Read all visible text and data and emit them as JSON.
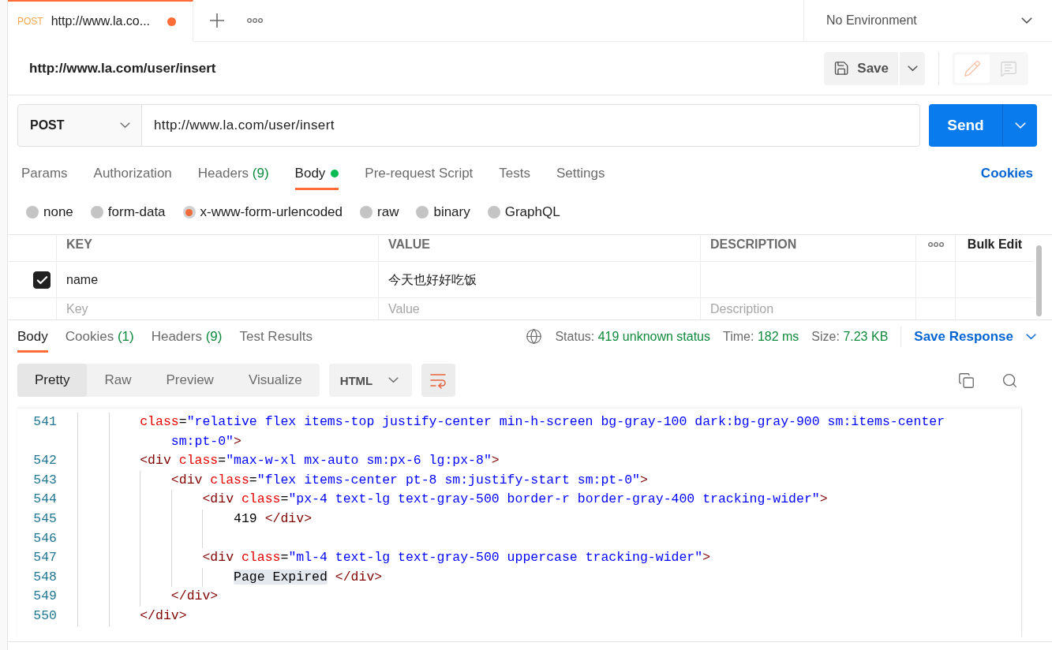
{
  "tab_bar": {
    "tabs": [
      {
        "method": "POST",
        "title": "http://www.la.co...",
        "selected": true,
        "unsaved": true
      }
    ],
    "environment": "No Environment"
  },
  "request": {
    "name": "http://www.la.com/user/insert",
    "save_label": "Save",
    "modes": [
      {
        "kind": "edit",
        "selected": true
      },
      {
        "kind": "comments",
        "selected": false
      }
    ],
    "method": "POST",
    "url": "http://www.la.com/user/insert",
    "send_label": "Send"
  },
  "request_tabs": [
    {
      "label": "Params",
      "selected": false,
      "dot": false
    },
    {
      "label": "Authorization",
      "selected": false,
      "dot": false
    },
    {
      "label": "Headers",
      "count": "(9)",
      "selected": false,
      "dot": false
    },
    {
      "label": "Body",
      "selected": true,
      "dot": true
    },
    {
      "label": "Pre-request Script",
      "selected": false,
      "dot": false
    },
    {
      "label": "Tests",
      "selected": false,
      "dot": false
    },
    {
      "label": "Settings",
      "selected": false,
      "dot": false
    }
  ],
  "cookies_link": "Cookies",
  "body_types": [
    {
      "label": "none",
      "selected": false
    },
    {
      "label": "form-data",
      "selected": false
    },
    {
      "label": "x-www-form-urlencoded",
      "selected": true
    },
    {
      "label": "raw",
      "selected": false
    },
    {
      "label": "binary",
      "selected": false
    },
    {
      "label": "GraphQL",
      "selected": false
    }
  ],
  "params_table": {
    "columns": [
      "KEY",
      "VALUE",
      "DESCRIPTION"
    ],
    "bulk_edit": "Bulk Edit",
    "rows": [
      {
        "checked": true,
        "key": "name",
        "value": "今天也好好吃饭"
      }
    ],
    "new_row": {
      "key_placeholder": "Key",
      "value_placeholder": "Value",
      "description_placeholder": "Description"
    }
  },
  "response": {
    "tabs": [
      {
        "label": "Body",
        "selected": true
      },
      {
        "label": "Cookies",
        "count": "(1)",
        "selected": false
      },
      {
        "label": "Headers",
        "count": "(9)",
        "selected": false
      },
      {
        "label": "Test Results",
        "selected": false
      }
    ],
    "status": {
      "label": "Status:",
      "value": "419 unknown status"
    },
    "time": {
      "label": "Time:",
      "value": "182 ms"
    },
    "size": {
      "label": "Size:",
      "value": "7.23 KB"
    },
    "save_response": "Save Response",
    "view_modes": [
      {
        "label": "Pretty",
        "selected": true
      },
      {
        "label": "Raw",
        "selected": false
      },
      {
        "label": "Preview",
        "selected": false
      },
      {
        "label": "Visualize",
        "selected": false
      }
    ],
    "language": "HTML",
    "wrap_lines": true,
    "code_starts_inside_tag": true,
    "code_lines": [
      {
        "number": "541",
        "code": "        class=\"relative flex items-top justify-center min-h-screen bg-gray-100 dark:bg-gray-900 sm:items-center sm:pt-0\">",
        "highlighted": false
      },
      {
        "number": "542",
        "code": "        <div class=\"max-w-xl mx-auto sm:px-6 lg:px-8\">",
        "highlighted": false
      },
      {
        "number": "543",
        "code": "            <div class=\"flex items-center pt-8 sm:justify-start sm:pt-0\">",
        "highlighted": false
      },
      {
        "number": "544",
        "code": "                <div class=\"px-4 text-lg text-gray-500 border-r border-gray-400 tracking-wider\">",
        "highlighted": false
      },
      {
        "number": "545",
        "code": "                    419 </div>",
        "highlighted": false
      },
      {
        "number": "546"
      },
      {
        "number": "547",
        "code": "                <div class=\"ml-4 text-lg text-gray-500 uppercase tracking-wider\">",
        "highlighted": false
      },
      {
        "number": "548",
        "code": "                    Page Expired </div>",
        "highlighted": true
      },
      {
        "number": "549",
        "code": "            </div>",
        "highlighted": false
      },
      {
        "number": "550",
        "code": "        </div>",
        "highlighted": false
      }
    ]
  }
}
